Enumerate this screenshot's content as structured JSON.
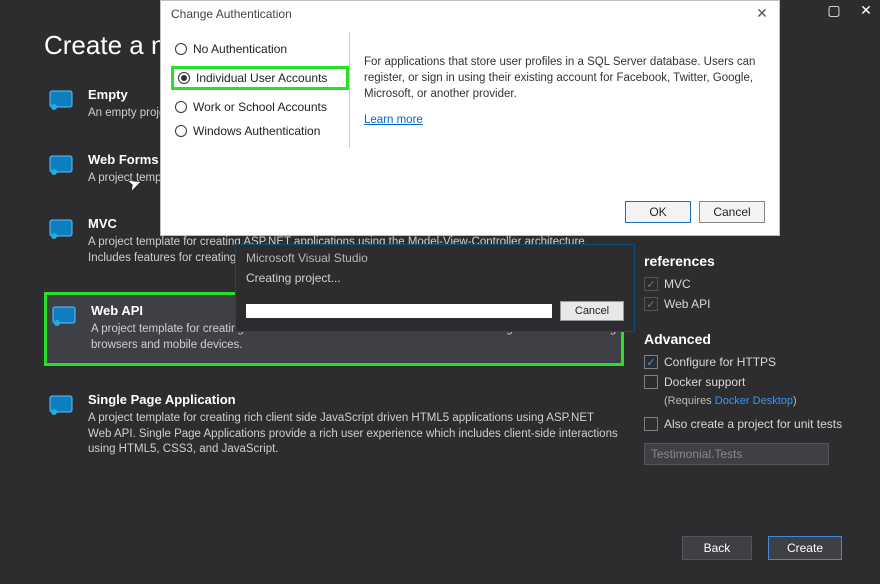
{
  "window": {
    "title": "Create a new ASP.NET Web Application"
  },
  "page_title_visible": "Create a n",
  "templates": [
    {
      "name": "Empty",
      "desc": "An empty project"
    },
    {
      "name": "Web Forms",
      "desc": "A project template using a familiar controls model that lets you rapidly build"
    },
    {
      "name": "MVC",
      "desc": "A project template for creating ASP.NET applications using the Model-View-Controller architecture. Includes features for creating applications that use the"
    },
    {
      "name": "Web API",
      "desc": "A project template for creating RESTful HTTP services that can reach a broad range of clients including browsers and mobile devices."
    },
    {
      "name": "Single Page Application",
      "desc": "A project template for creating rich client side JavaScript driven HTML5 applications using ASP.NET Web API. Single Page Applications provide a rich user experience which includes client-side interactions using HTML5, CSS3, and JavaScript."
    }
  ],
  "references": {
    "heading": "references",
    "items": [
      "MVC",
      "Web API"
    ]
  },
  "advanced": {
    "heading": "Advanced",
    "configure_https": "Configure for HTTPS",
    "docker_support": "Docker support",
    "requires_prefix": "(Requires ",
    "requires_link": "Docker Desktop",
    "requires_suffix": ")",
    "unit_tests": "Also create a project for unit tests",
    "unit_tests_name": "Testimonial.Tests"
  },
  "bottom": {
    "back": "Back",
    "create": "Create"
  },
  "progress": {
    "title": "Microsoft Visual Studio",
    "message": "Creating project...",
    "cancel": "Cancel"
  },
  "auth": {
    "title": "Change Authentication",
    "options": [
      "No Authentication",
      "Individual User Accounts",
      "Work or School Accounts",
      "Windows Authentication"
    ],
    "selected_index": 1,
    "description": "For applications that store user profiles in a SQL Server database. Users can register, or sign in using their existing account for Facebook, Twitter, Google, Microsoft, or another provider.",
    "learn_more": "Learn more",
    "ok": "OK",
    "cancel": "Cancel"
  }
}
